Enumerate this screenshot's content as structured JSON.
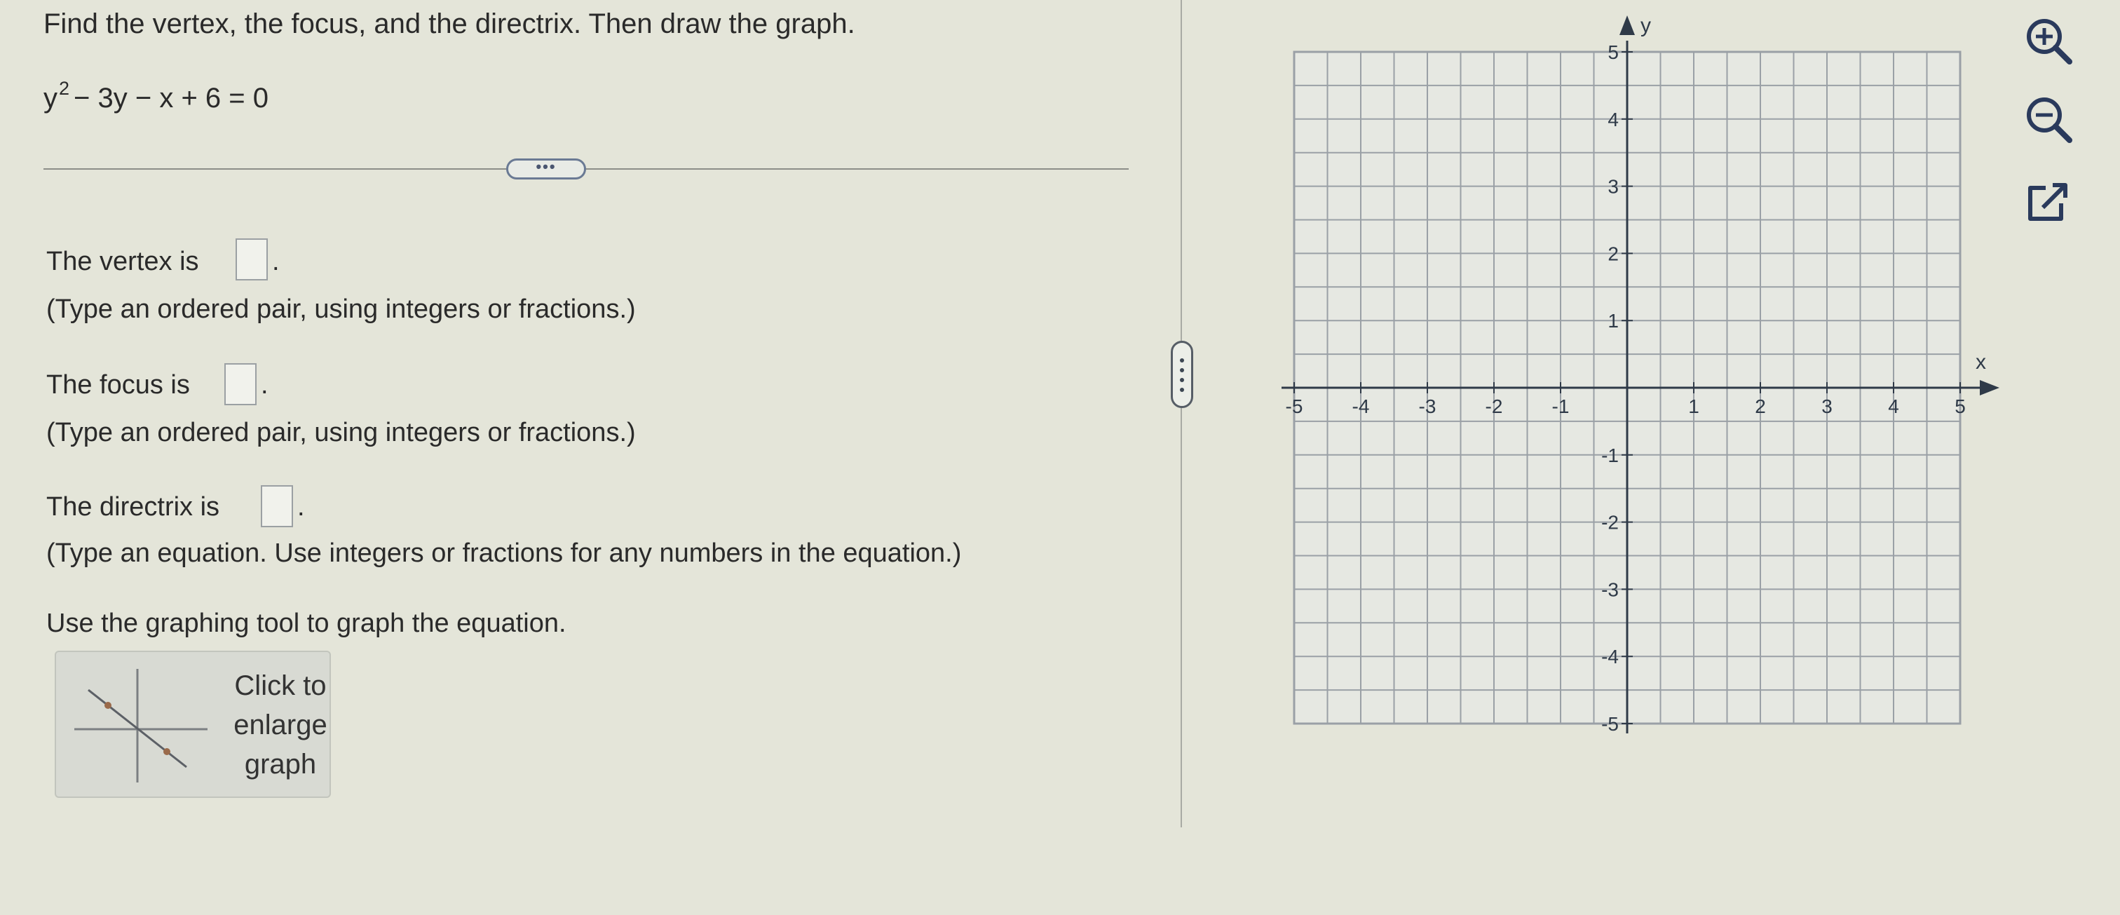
{
  "question": {
    "prompt": "Find the vertex, the focus, and the directrix. Then draw the graph.",
    "equation_base": "y",
    "equation_exp": "2",
    "equation_rest": "− 3y − x + 6 = 0",
    "more_button": "•••"
  },
  "answers": {
    "vertex_label": "The vertex is",
    "vertex_hint": "(Type an ordered pair, using integers or fractions.)",
    "focus_label": "The focus is",
    "focus_hint": "(Type an ordered pair, using integers or fractions.)",
    "directrix_label": "The directrix is",
    "directrix_hint": "(Type an equation. Use integers or fractions for any numbers in the equation.)",
    "period": "."
  },
  "graph_tool": {
    "instruction": "Use the graphing tool to graph the equation.",
    "thumbnail_label": "Click to enlarge graph"
  },
  "graph": {
    "x_axis_label": "x",
    "y_axis_label": "y",
    "x_min": -5,
    "x_max": 5,
    "y_min": -5,
    "y_max": 5,
    "step": 1,
    "minor_divisions": 2,
    "x_tick_labels": [
      "-5",
      "-4",
      "-3",
      "-2",
      "-1",
      "1",
      "2",
      "3",
      "4",
      "5"
    ],
    "y_tick_labels": [
      "5",
      "4",
      "3",
      "2",
      "1",
      "-1",
      "-2",
      "-3",
      "-4",
      "-5"
    ]
  },
  "toolbar": {
    "zoom_in_icon": "zoom-in-icon",
    "zoom_out_icon": "zoom-out-icon",
    "popout_icon": "external-link-icon"
  },
  "colors": {
    "background": "#e4e5d9",
    "grid_line": "#9aa0a6",
    "axis": "#2f3a48",
    "icon_stroke": "#2a3a5c"
  }
}
